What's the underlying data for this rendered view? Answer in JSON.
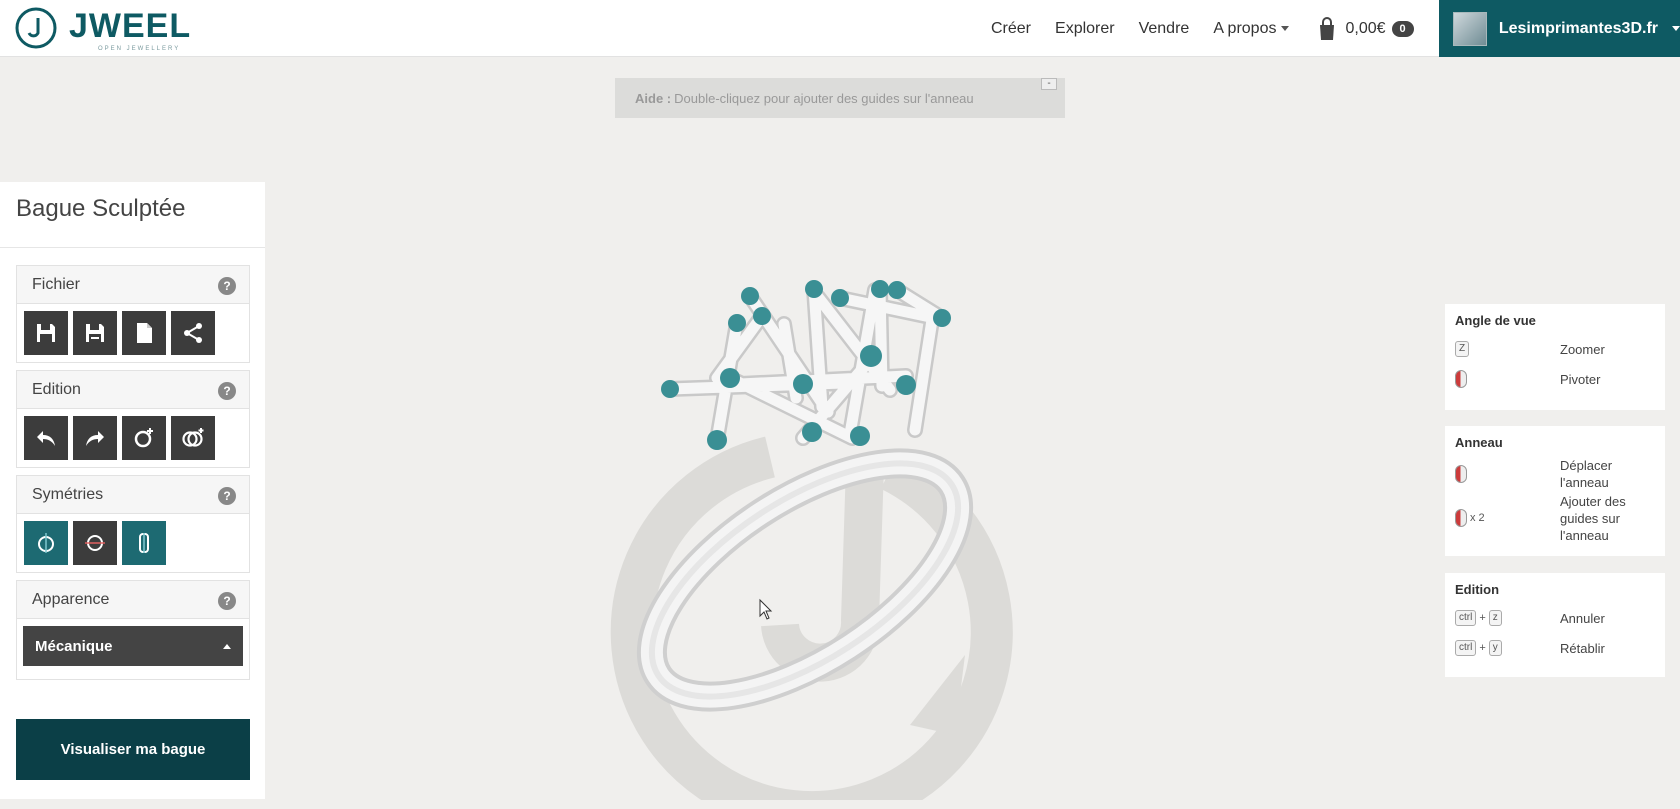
{
  "header": {
    "logo_text": "JWEEL",
    "logo_tagline": "OPEN JEWELLERY",
    "nav": [
      "Créer",
      "Explorer",
      "Vendre",
      "A propos"
    ],
    "cart": {
      "total": "0,00€",
      "count": "0"
    },
    "user": {
      "name": "Lesimprimantes3D.fr"
    }
  },
  "help_bar": {
    "label": "Aide :",
    "text": "Double-cliquez pour ajouter des guides sur l'anneau",
    "close_label": "-"
  },
  "left_panel": {
    "title": "Bague Sculptée",
    "sections": {
      "fichier": {
        "title": "Fichier",
        "help": "?"
      },
      "edition": {
        "title": "Edition",
        "help": "?"
      },
      "symetries": {
        "title": "Symétries",
        "help": "?"
      },
      "apparence": {
        "title": "Apparence",
        "help": "?",
        "selected": "Mécanique"
      }
    },
    "visualize_button": "Visualiser ma bague"
  },
  "shortcuts": {
    "angle": {
      "title": "Angle de vue",
      "rows": [
        {
          "key": "Z",
          "desc": "Zoomer"
        },
        {
          "key": "",
          "desc": "Pivoter"
        }
      ]
    },
    "anneau": {
      "title": "Anneau",
      "rows": [
        {
          "key": "",
          "desc": "Déplacer l'anneau"
        },
        {
          "key": "x 2",
          "desc": "Ajouter des guides sur l'anneau"
        }
      ]
    },
    "edition": {
      "title": "Edition",
      "rows": [
        {
          "key1": "ctrl",
          "plus": "+",
          "key2": "z",
          "desc": "Annuler"
        },
        {
          "key1": "ctrl",
          "plus": "+",
          "key2": "y",
          "desc": "Rétablir"
        }
      ]
    }
  },
  "colors": {
    "brand_teal": "#0e5a63",
    "dark_button": "#0b3f47",
    "node_teal": "#3a8f94"
  }
}
